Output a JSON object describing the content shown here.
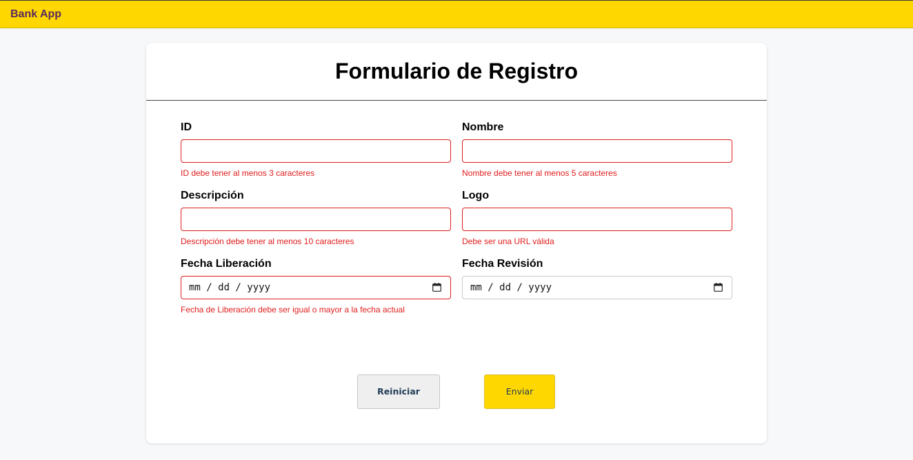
{
  "app": {
    "title": "Bank App",
    "accent_color": "#ffd700",
    "error_color": "#e01b1b"
  },
  "form": {
    "title": "Formulario de Registro",
    "fields": {
      "id": {
        "label": "ID",
        "value": "",
        "error": "ID debe tener al menos 3 caracteres"
      },
      "nombre": {
        "label": "Nombre",
        "value": "",
        "error": "Nombre debe tener al menos 5 caracteres"
      },
      "descripcion": {
        "label": "Descripción",
        "value": "",
        "error": "Descripción debe tener al menos 10 caracteres"
      },
      "logo": {
        "label": "Logo",
        "value": "",
        "error": "Debe ser una URL válida"
      },
      "fecha_liberacion": {
        "label": "Fecha Liberación",
        "value": "mm / dd / yyyy",
        "icon": "calendar-icon",
        "error": "Fecha de Liberación debe ser igual o mayor a la fecha actual"
      },
      "fecha_revision": {
        "label": "Fecha Revisión",
        "value": "mm / dd / yyyy",
        "icon": "calendar-icon"
      }
    },
    "buttons": {
      "reset_label": "Reiniciar",
      "submit_label": "Enviar"
    }
  }
}
